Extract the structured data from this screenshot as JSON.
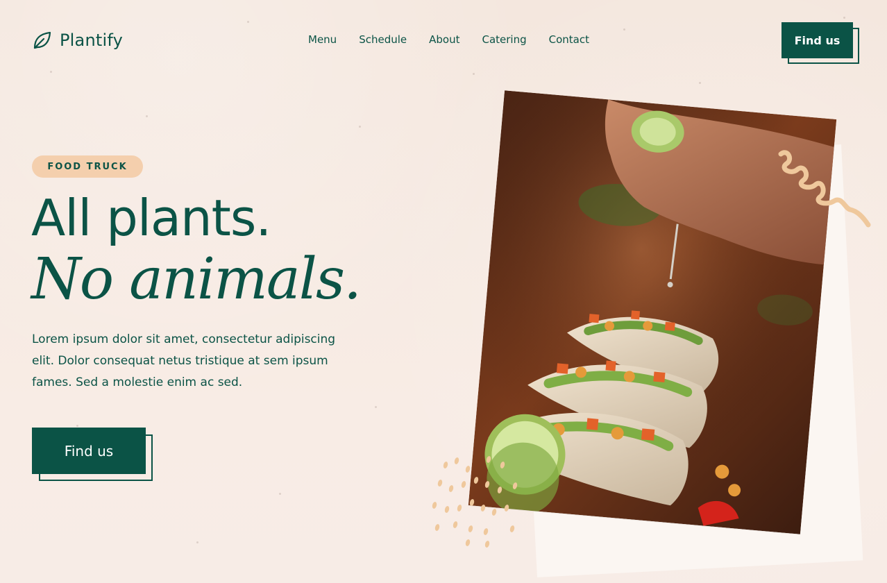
{
  "brand": {
    "name": "Plantify",
    "logo_icon": "leaf-icon",
    "color": "#0b5346",
    "accent": "#f4cfad",
    "background": "#f6e9e0"
  },
  "nav": {
    "items": [
      {
        "label": "Menu"
      },
      {
        "label": "Schedule"
      },
      {
        "label": "About"
      },
      {
        "label": "Catering"
      },
      {
        "label": "Contact"
      }
    ],
    "cta_label": "Find us"
  },
  "hero": {
    "badge": "FOOD TRUCK",
    "headline_line1": "All plants.",
    "headline_line2": "No animals.",
    "paragraph": "Lorem ipsum dolor sit amet, consectetur adipiscing elit. Dolor consequat netus tristique at sem ipsum fames. Sed a molestie enim ac sed.",
    "cta_label": "Find us",
    "image_icon": "tacos-photo"
  }
}
